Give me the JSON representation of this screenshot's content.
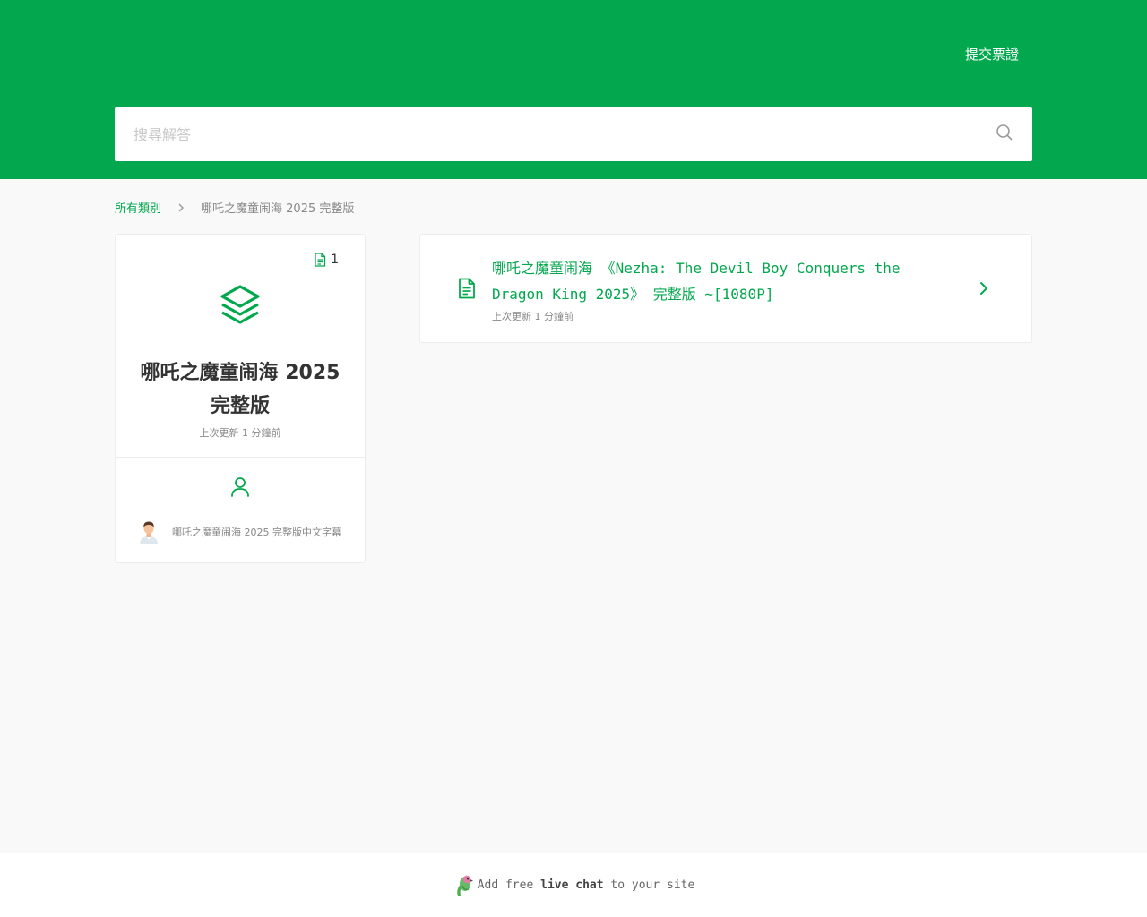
{
  "header": {
    "submit_ticket_label": "提交票證",
    "search_placeholder": "搜尋解答"
  },
  "breadcrumb": {
    "root_label": "所有類別",
    "current_label": "哪吒之魔童闹海 2025 完整版"
  },
  "category": {
    "doc_count": "1",
    "title": "哪吒之魔童闹海 2025 完整版",
    "updated": "上次更新 1 分鐘前",
    "author_name": "哪吒之魔童闹海 2025 完整版中文字幕"
  },
  "articles": [
    {
      "title": "哪吒之魔童闹海 《Nezha: The Devil Boy Conquers the Dragon King 2025》 完整版 ~[1080P]",
      "updated": "上次更新 1 分鐘前"
    }
  ],
  "footer": {
    "prefix": "Add free",
    "highlight": "live chat",
    "suffix": "to your site"
  },
  "colors": {
    "accent": "#03a84e",
    "background": "#f9f9f9"
  }
}
